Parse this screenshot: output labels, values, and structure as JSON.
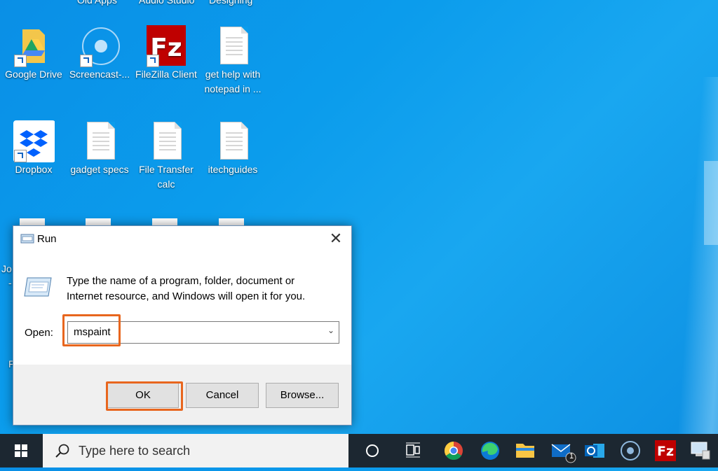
{
  "desktop": {
    "top_cut_labels": [
      "Old Apps",
      "Audio Studio",
      "Designing"
    ],
    "icons": [
      {
        "name": "google-drive",
        "label": "Google Drive"
      },
      {
        "name": "screencast",
        "label": "Screencast-..."
      },
      {
        "name": "filezilla-client",
        "label": "FileZilla Client"
      },
      {
        "name": "get-help-notepad",
        "label": "get help with\nnotepad in ..."
      },
      {
        "name": "dropbox",
        "label": "Dropbox"
      },
      {
        "name": "gadget-specs",
        "label": "gadget specs"
      },
      {
        "name": "file-transfer-calc",
        "label": "File Transfer\ncalc"
      },
      {
        "name": "itechguides",
        "label": "itechguides"
      }
    ],
    "partial_labels": [
      "Jo",
      "-",
      "F"
    ]
  },
  "run_dialog": {
    "title": "Run",
    "description": "Type the name of a program, folder, document or Internet resource, and Windows will open it for you.",
    "open_label": "Open:",
    "open_value": "mspaint",
    "ok_label": "OK",
    "cancel_label": "Cancel",
    "browse_label": "Browse...",
    "highlight_color": "#e8661e"
  },
  "taskbar": {
    "search_placeholder": "Type here to search",
    "mail_badge": "1",
    "icons": [
      "windows-start-icon",
      "search-icon",
      "cortana-icon",
      "task-view-icon",
      "chrome-icon",
      "edge-icon",
      "file-explorer-icon",
      "mail-icon",
      "outlook-icon",
      "screencast-icon",
      "filezilla-icon",
      "network-icon"
    ]
  }
}
